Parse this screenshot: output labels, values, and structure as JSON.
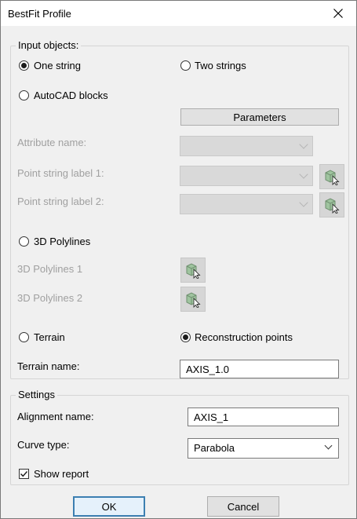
{
  "window": {
    "title": "BestFit Profile"
  },
  "input_group": {
    "legend": "Input objects:",
    "one_string": "One string",
    "two_strings": "Two strings",
    "autocad_blocks": "AutoCAD blocks",
    "parameters_button": "Parameters",
    "attribute_name": "Attribute name:",
    "point_string_label_1": "Point string label 1:",
    "point_string_label_2": "Point string label 2:",
    "polylines_3d": "3D Polylines",
    "polylines_3d_1": "3D Polylines 1",
    "polylines_3d_2": "3D Polylines 2",
    "terrain": "Terrain",
    "reconstruction_points": "Reconstruction points",
    "terrain_name_label": "Terrain name:",
    "terrain_name_value": "AXIS_1.0"
  },
  "settings_group": {
    "legend": "Settings",
    "alignment_name_label": "Alignment name:",
    "alignment_name_value": "AXIS_1",
    "curve_type_label": "Curve type:",
    "curve_type_value": "Parabola",
    "show_report": "Show report"
  },
  "buttons": {
    "ok": "OK",
    "cancel": "Cancel"
  }
}
